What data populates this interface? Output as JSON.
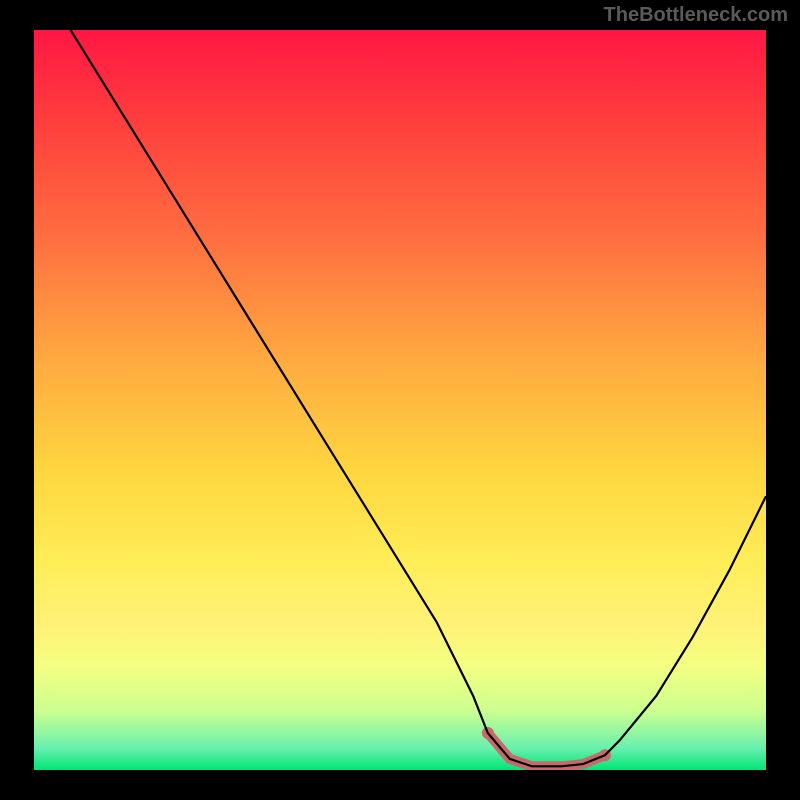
{
  "watermark": "TheBottleneck.com",
  "chart_data": {
    "type": "line",
    "title": "",
    "xlabel": "",
    "ylabel": "",
    "xlim": [
      0,
      100
    ],
    "ylim": [
      0,
      100
    ],
    "series": [
      {
        "name": "curve",
        "x": [
          5,
          10,
          15,
          20,
          25,
          30,
          35,
          40,
          45,
          50,
          55,
          60,
          62,
          65,
          68,
          72,
          75,
          78,
          80,
          85,
          90,
          95,
          100
        ],
        "values": [
          100,
          92,
          84,
          76,
          68,
          60,
          52,
          44,
          36,
          28,
          20,
          10,
          5,
          1.5,
          0.5,
          0.5,
          0.8,
          2,
          4,
          10,
          18,
          27,
          37
        ]
      }
    ],
    "highlight_range_x": [
      62,
      78
    ],
    "gradient_colors": [
      "#ff1744",
      "#ffd740",
      "#00e676"
    ]
  }
}
